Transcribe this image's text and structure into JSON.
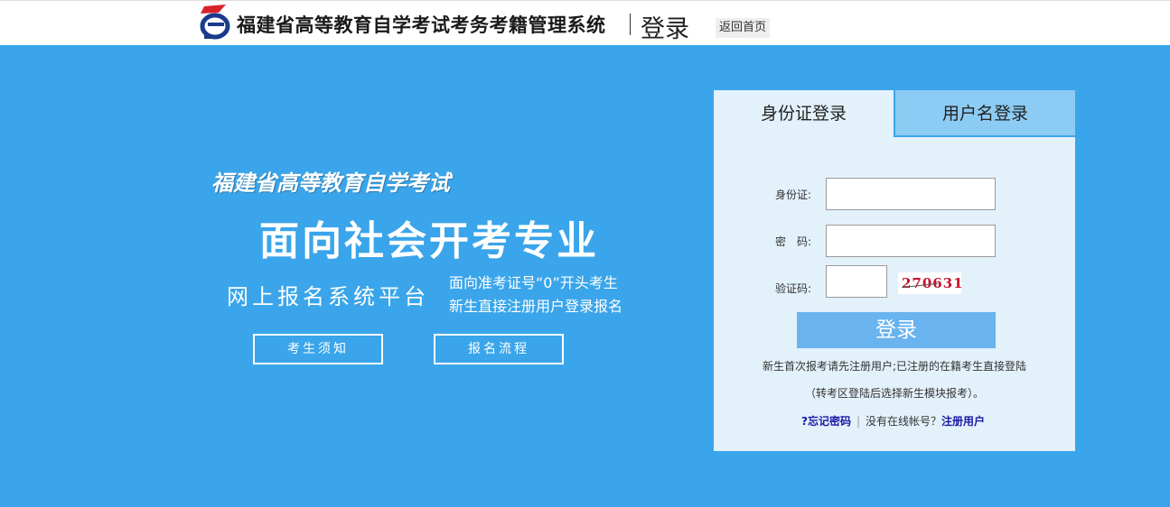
{
  "header": {
    "system_title": "福建省高等教育自学考试考务考籍管理系统",
    "login_word": "登录",
    "home_button": "返回首页"
  },
  "promo": {
    "small_title": "福建省高等教育自学考试",
    "big_title": "面向社会开考专业",
    "subtitle": "网上报名系统平台",
    "note_line1": "面向准考证号“0”开头考生",
    "note_line2": "新生直接注册用户登录报名",
    "button_notice": "考生须知",
    "button_flow": "报名流程"
  },
  "login_panel": {
    "tab_id": "身份证登录",
    "tab_username": "用户名登录",
    "active_tab": "身份证登录",
    "id_label": "身份证:",
    "password_label": "密　码:",
    "captcha_label": "验证码:",
    "id_value": "",
    "password_value": "",
    "captcha_value": "",
    "captcha_image_text": "270631",
    "submit_button": "登录",
    "hint_line1": "新生首次报考请先注册用户;已注册的在籍考生直接登陆",
    "hint_line2": "（转考区登陆后选择新生模块报考）。",
    "forgot_password": "?忘记密码",
    "no_account_text": "没有在线帐号？",
    "register_link": "注册用户"
  },
  "colors": {
    "background_blue": "#3aa5ea",
    "panel_bg": "#e3f1fb",
    "inactive_tab": "#8ccbf4",
    "login_button": "#69b3ef",
    "link_blue": "#1a1aa6"
  },
  "icons": {
    "logo": "exam-system-logo"
  }
}
